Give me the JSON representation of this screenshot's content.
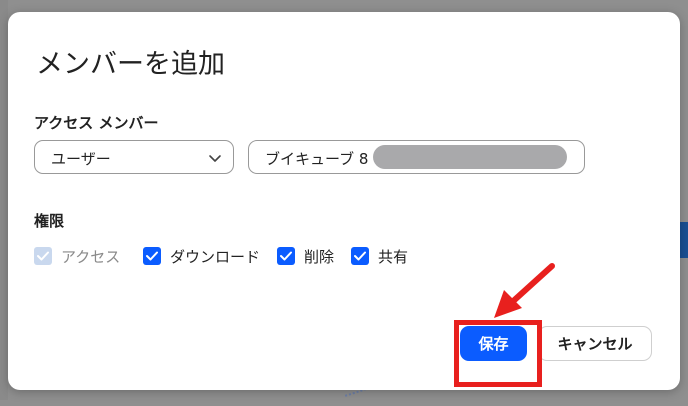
{
  "dialog": {
    "title": "メンバーを追加",
    "access_label": "アクセス メンバー",
    "member_type": {
      "selected": "ユーザー"
    },
    "member_field": {
      "value": "ブイキューブ 8"
    },
    "permissions_label": "権限",
    "permissions": [
      {
        "label": "アクセス",
        "checked": true,
        "disabled": true
      },
      {
        "label": "ダウンロード",
        "checked": true,
        "disabled": false
      },
      {
        "label": "削除",
        "checked": true,
        "disabled": false
      },
      {
        "label": "共有",
        "checked": true,
        "disabled": false
      }
    ],
    "save_label": "保存",
    "cancel_label": "キャンセル"
  },
  "colors": {
    "primary": "#0b5cff",
    "annotation": "#e8201e",
    "overlay": "#8f8f8f"
  },
  "icons": {
    "dropdown": "chevron-down-icon",
    "check": "check-icon",
    "pointer": "red-arrow-icon"
  }
}
